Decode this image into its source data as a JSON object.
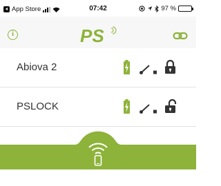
{
  "status_bar": {
    "back_label": "App Store",
    "time": "07:42",
    "battery_text": "97 %",
    "battery_level": 0.97
  },
  "nav": {
    "info_symbol": "i",
    "logo_text": "PS",
    "info_icon": "info-circle-icon",
    "link_icon": "link-chain-icon"
  },
  "colors": {
    "accent": "#8db33a",
    "text": "#333333"
  },
  "devices": [
    {
      "name": "Abiova 2",
      "battery_icon": "battery-charging-icon",
      "contact_icon": "switch-contact-icon",
      "lock_state": "locked"
    },
    {
      "name": "PSLOCK",
      "battery_icon": "battery-charging-icon",
      "contact_icon": "switch-contact-icon",
      "lock_state": "unlocked"
    }
  ],
  "footer": {
    "icon": "wifi-phone-icon"
  }
}
